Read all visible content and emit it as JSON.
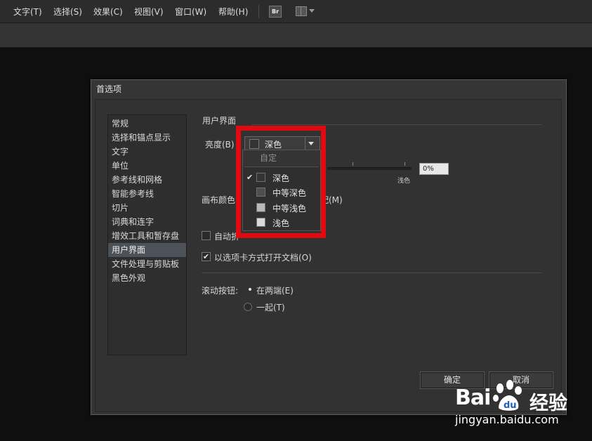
{
  "menubar": {
    "items": [
      "文字(T)",
      "选择(S)",
      "效果(C)",
      "视图(V)",
      "窗口(W)",
      "帮助(H)"
    ],
    "bridge_label": "Br"
  },
  "dialog": {
    "title": "首选项",
    "categories": [
      "常规",
      "选择和锚点显示",
      "文字",
      "单位",
      "参考线和网格",
      "智能参考线",
      "切片",
      "词典和连字",
      "增效工具和暂存盘",
      "用户界面",
      "文件处理与剪贴板",
      "黑色外观"
    ],
    "selected_category": "用户界面",
    "section_title": "用户界面",
    "brightness": {
      "label": "亮度(B)",
      "selected": "深色",
      "slider_light_label": "浅色",
      "value": "0%",
      "options": {
        "custom": "自定",
        "items": [
          {
            "label": "深色",
            "swatch": "#333333",
            "checked": true
          },
          {
            "label": "中等深色",
            "swatch": "#4f4f4f",
            "checked": false
          },
          {
            "label": "中等浅色",
            "swatch": "#b8b8b8",
            "checked": false
          },
          {
            "label": "浅色",
            "swatch": "#d8d8d8",
            "checked": false
          }
        ]
      }
    },
    "canvas_color": {
      "label_prefix": "画布颜色",
      "label_suffix": "配(M)"
    },
    "auto_collapse": {
      "label": "自动折",
      "checked": false
    },
    "open_as_tabs": {
      "label": "以选项卡方式打开文档(O)",
      "checked": true
    },
    "scroll_buttons": {
      "label": "滚动按钮:",
      "options": [
        {
          "label": "在两端(E)",
          "selected": true
        },
        {
          "label": "一起(T)",
          "selected": false
        }
      ]
    },
    "buttons": {
      "ok": "确定",
      "cancel": "取消"
    }
  },
  "watermark": {
    "brand_left": "Bai",
    "brand_right": "经验",
    "url": "jingyan.baidu.com"
  },
  "colors": {
    "highlight": "#e00b10",
    "selected_row": "#4d5159",
    "dialog_bg": "#353535"
  }
}
